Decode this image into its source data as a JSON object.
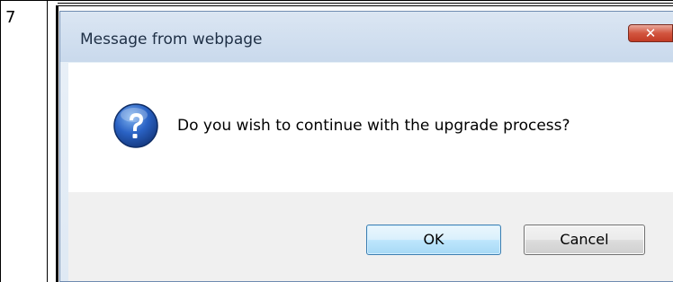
{
  "step": {
    "number": "7"
  },
  "dialog": {
    "title": "Message from webpage",
    "close_label": "✕",
    "icon": "question-icon",
    "message": "Do you wish to continue with the upgrade process?",
    "ok_label": "OK",
    "cancel_label": "Cancel"
  },
  "colors": {
    "titlebar": "#c9d9ec",
    "close_button": "#c23b24",
    "ok_button_border": "#3c7fb1",
    "icon_blue": "#1f4fa8"
  }
}
